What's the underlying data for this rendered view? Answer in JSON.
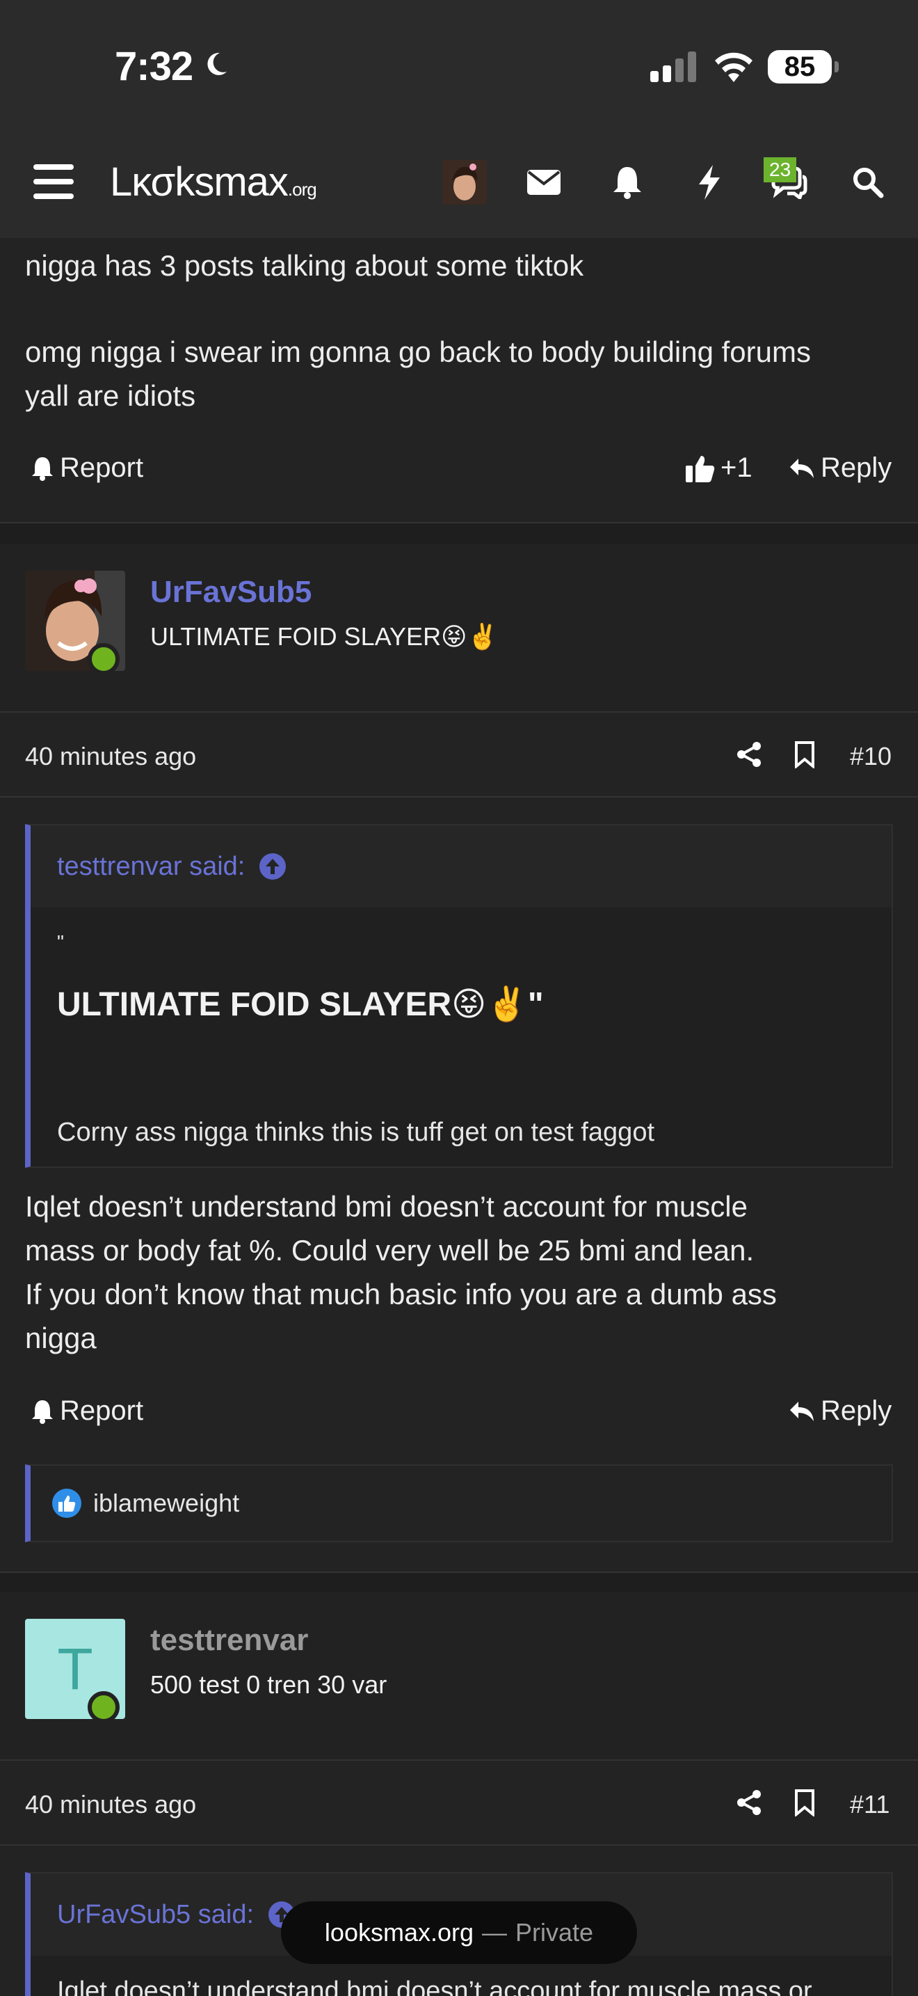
{
  "status_bar": {
    "time": "7:32",
    "battery": "85"
  },
  "header": {
    "logo_main": "Lκσksmax",
    "logo_suffix": ".org",
    "conversations_badge": "23",
    "icons": [
      "menu-icon",
      "avatar",
      "envelope-icon",
      "bell-icon",
      "bolt-icon",
      "chat-icon",
      "search-icon"
    ]
  },
  "post_top": {
    "line1": "nigga has 3 posts talking about some tiktok",
    "line2": "omg nigga i swear im gonna go back to body building forums",
    "line3": "yall are idiots",
    "report": "Report",
    "like_count": "+1",
    "reply": "Reply"
  },
  "post10": {
    "username": "UrFavSub5",
    "user_title": "ULTIMATE FOID SLAYER😝✌️",
    "time": "40 minutes ago",
    "number": "#10",
    "quote": {
      "author": "testtrenvar said:",
      "open_mark": "\"",
      "headline": "ULTIMATE FOID SLAYER😝✌️\"",
      "text": "Corny ass nigga thinks this is tuff get on test faggot"
    },
    "body_line1": "Iqlet doesn’t understand bmi doesn’t account for muscle",
    "body_line2": "mass or body fat %. Could very well be 25 bmi and lean.",
    "body_line3": "If you don’t know that much basic info you are a dumb ass",
    "body_line4": "nigga",
    "report": "Report",
    "reply": "Reply",
    "reaction_user": "iblameweight"
  },
  "post11": {
    "username": "testtrenvar",
    "avatar_letter": "T",
    "user_title": "500 test 0 tren 30 var",
    "time": "40 minutes ago",
    "number": "#11",
    "quote_author": "UrFavSub5 said:",
    "quote_text": "Iqlet doesn’t understand bmi doesn’t account for muscle mass or"
  },
  "browser_pill": {
    "domain": "looksmax.org",
    "separator": "—",
    "mode": "Private"
  },
  "colors": {
    "accent": "#5c64c8",
    "online": "#6fb41f",
    "badge": "#6cb32e",
    "background": "#232323"
  }
}
